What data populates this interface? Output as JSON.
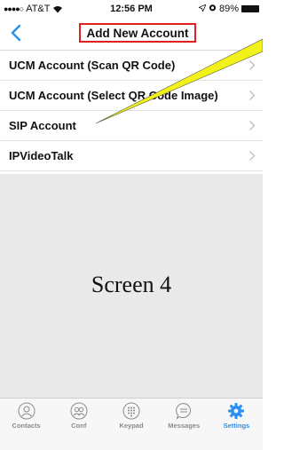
{
  "status_bar": {
    "signal": "●●●●○",
    "carrier": "AT&T",
    "time": "12:56 PM",
    "battery": "89%"
  },
  "nav": {
    "title": "Add New Account"
  },
  "menu": {
    "items": [
      {
        "label": "UCM Account (Scan QR Code)"
      },
      {
        "label": "UCM Account (Select QR Code Image)"
      },
      {
        "label": "SIP Account"
      },
      {
        "label": "IPVideoTalk"
      }
    ]
  },
  "content": {
    "screen_label": "Screen 4"
  },
  "tabs": {
    "items": [
      {
        "label": "Contacts",
        "icon": "contacts-icon"
      },
      {
        "label": "Conf",
        "icon": "conference-icon"
      },
      {
        "label": "Keypad",
        "icon": "keypad-icon"
      },
      {
        "label": "Messages",
        "icon": "messages-icon"
      },
      {
        "label": "Settings",
        "icon": "settings-icon"
      }
    ],
    "active": "Settings"
  },
  "colors": {
    "accent": "#2a8ff0",
    "highlight_border": "#e02020",
    "callout_fill": "#f2f21a",
    "content_bg": "#e9e9e9"
  }
}
